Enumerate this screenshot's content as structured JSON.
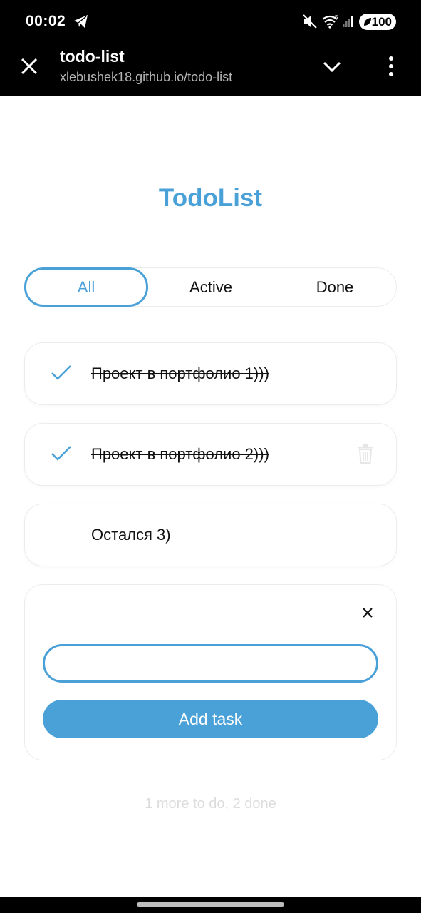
{
  "status_bar": {
    "time": "00:02",
    "battery": "100",
    "signal_label": "5"
  },
  "browser": {
    "title": "todo-list",
    "url": "xlebushek18.github.io/todo-list"
  },
  "app": {
    "title": "TodoList",
    "filters": [
      {
        "label": "All",
        "selected": true
      },
      {
        "label": "Active",
        "selected": false
      },
      {
        "label": "Done",
        "selected": false
      }
    ],
    "tasks": [
      {
        "text": "Проект в портфолио 1)))",
        "done": true
      },
      {
        "text": "Проект в портфолио 2)))",
        "done": true
      },
      {
        "text": "Остался 3)",
        "done": false
      }
    ],
    "add_panel": {
      "input_value": "",
      "button_label": "Add task"
    },
    "summary": "1 more to do, 2 done"
  },
  "colors": {
    "accent": "#4aa1d8",
    "text": "#111111",
    "muted": "#dcdcdc"
  }
}
